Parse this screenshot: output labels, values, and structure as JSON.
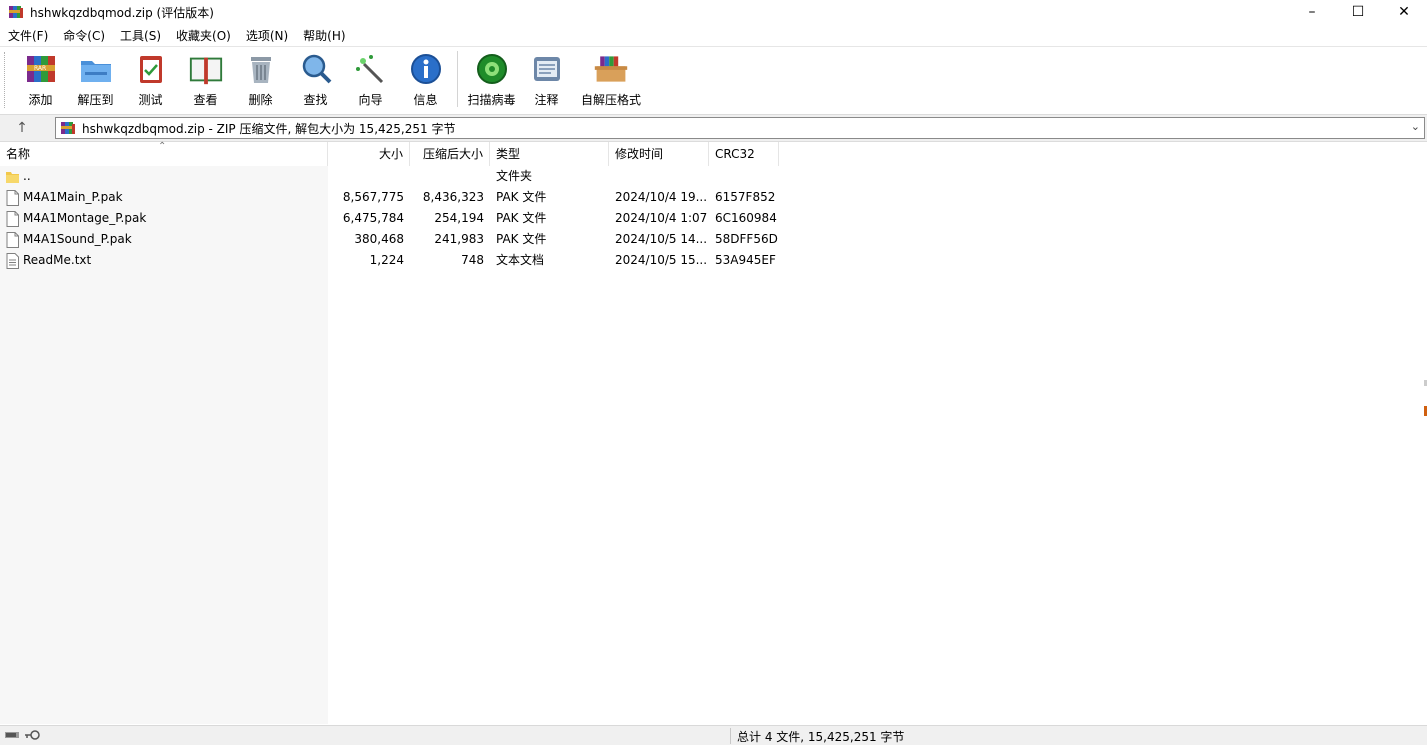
{
  "window": {
    "title": "hshwkqzdbqmod.zip (评估版本)",
    "minimize": "–",
    "maximize": "☐",
    "close": "✕"
  },
  "menu": [
    "文件(F)",
    "命令(C)",
    "工具(S)",
    "收藏夹(O)",
    "选项(N)",
    "帮助(H)"
  ],
  "toolbar": {
    "add": "添加",
    "extract": "解压到",
    "test": "测试",
    "view": "查看",
    "delete": "删除",
    "find": "查找",
    "wizard": "向导",
    "info": "信息",
    "virus_scan": "扫描病毒",
    "comment": "注释",
    "sfx": "自解压格式"
  },
  "address": {
    "up": "↑",
    "path": "hshwkqzdbqmod.zip - ZIP 压缩文件, 解包大小为 15,425,251 字节",
    "dropdown": "⌄"
  },
  "columns": {
    "name": "名称",
    "size": "大小",
    "packed": "压缩后大小",
    "type": "类型",
    "modified": "修改时间",
    "crc": "CRC32",
    "sort_indicator": "⌃"
  },
  "files": [
    {
      "name": "..",
      "size": "",
      "packed": "",
      "type": "文件夹",
      "modified": "",
      "crc": "",
      "icon": "folder-icon"
    },
    {
      "name": "M4A1Main_P.pak",
      "size": "8,567,775",
      "packed": "8,436,323",
      "type": "PAK 文件",
      "modified": "2024/10/4 19...",
      "crc": "6157F852",
      "icon": "file-icon"
    },
    {
      "name": "M4A1Montage_P.pak",
      "size": "6,475,784",
      "packed": "254,194",
      "type": "PAK 文件",
      "modified": "2024/10/4 1:07",
      "crc": "6C160984",
      "icon": "file-icon"
    },
    {
      "name": "M4A1Sound_P.pak",
      "size": "380,468",
      "packed": "241,983",
      "type": "PAK 文件",
      "modified": "2024/10/5 14...",
      "crc": "58DFF56D",
      "icon": "file-icon"
    },
    {
      "name": "ReadMe.txt",
      "size": "1,224",
      "packed": "748",
      "type": "文本文档",
      "modified": "2024/10/5 15...",
      "crc": "53A945EF",
      "icon": "text-file-icon"
    }
  ],
  "status": {
    "summary": "总计 4 文件, 15,425,251 字节"
  }
}
